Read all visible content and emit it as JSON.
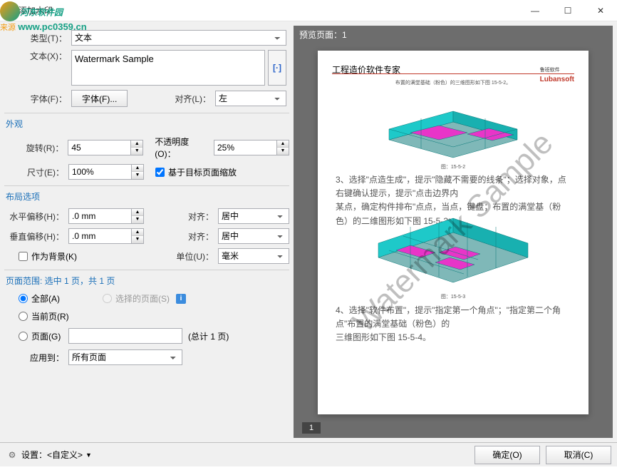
{
  "window": {
    "title": "添加水印",
    "minimize": "—",
    "maximize": "☐",
    "close": "✕"
  },
  "overlay": {
    "brand_text": "河东软件园",
    "source_label": "来源",
    "url": "www.pc0359.cn"
  },
  "labels": {
    "type": "类型(T)：",
    "text": "文本(X)：",
    "font": "字体(F)：",
    "align": "对齐(L)：",
    "appearance": "外观",
    "rotate": "旋转(R)：",
    "opacity": "不透明度(O)：",
    "size": "尺寸(E)：",
    "scale_to_page": "基于目标页面缩放",
    "layout": "布局选项",
    "h_offset": "水平偏移(H)：",
    "v_offset": "垂直偏移(H)：",
    "align2": "对齐：",
    "as_background": "作为背景(K)",
    "unit": "单位(U)：",
    "page_range": "页面范围: 选中 1 页，共 1 页",
    "all": "全部(A)",
    "selected_pages": "选择的页面(S)",
    "current": "当前页(R)",
    "pages": "页面(G)",
    "total_pages": "(总计 1 页)",
    "apply_to": "应用到：",
    "font_btn": "字体(F)..."
  },
  "values": {
    "type": "文本",
    "watermark_text": "Watermark Sample",
    "align_l": "左",
    "rotate": "45",
    "opacity": "25%",
    "size": "100%",
    "h_offset": ".0 mm",
    "v_offset": ".0 mm",
    "align_h": "居中",
    "align_v": "居中",
    "unit": "毫米",
    "pages_input": "",
    "apply_to": "所有页面",
    "scale_checked": true,
    "bg_checked": false
  },
  "preview": {
    "header": "预览页面：1",
    "page_num": "1",
    "doc_title": "工程造价软件专家",
    "brand": "Lubansoft",
    "brand_cn": "鲁班软件",
    "line1": "布置的满堂基础（粉色）的三维图形如下图 15-5-2。",
    "fig1": "图：15-5-2",
    "line2": "3、选择\"点造生成\"，提示\"隐藏不需要的线条\"；选择对象，点右键确认提示，提示\"点击边界内",
    "line3": "某点，确定构件排布\"点点，当点，键盘；布置的满堂基（粉色）的二维图形如下图 15-5-3。",
    "fig2": "图：15-5-3",
    "line4": "4、选择\"软件布置\"，提示\"指定第一个角点\"；\"指定第二个角点\"布置的满堂基础（粉色）的",
    "line5": "三维图形如下图 15-5-4。"
  },
  "footer": {
    "settings": "设置：<自定义>",
    "ok": "确定(O)",
    "cancel": "取消(C)"
  },
  "insert_var": "[·]"
}
